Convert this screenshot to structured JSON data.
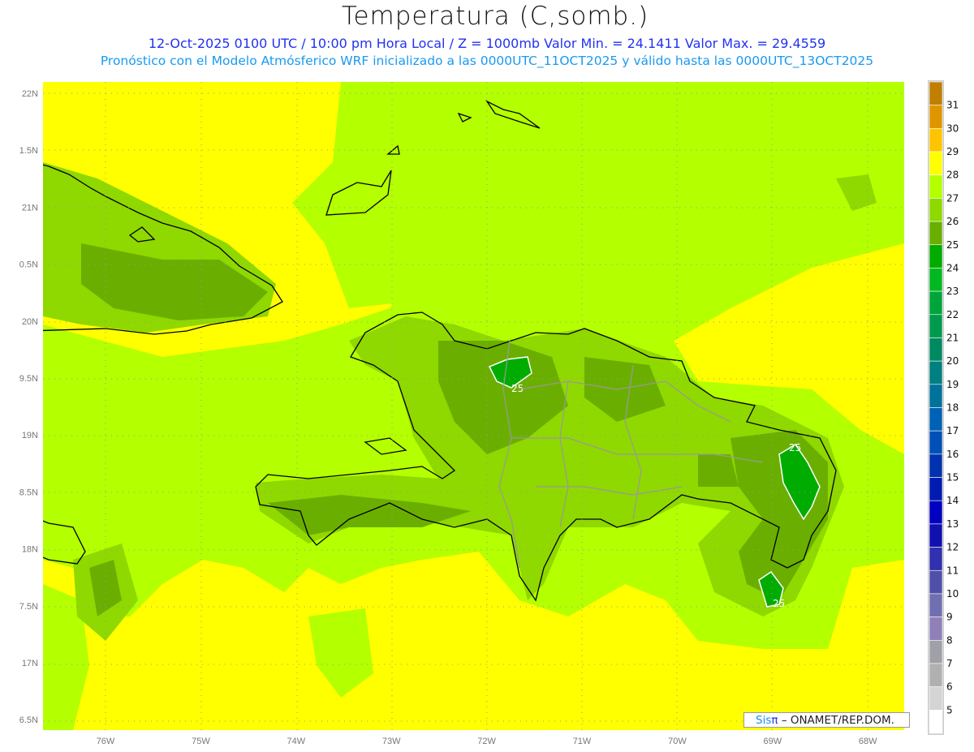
{
  "header": {
    "title": "Temperatura (C,somb.)",
    "subtitle1": "12-Oct-2025 0100 UTC / 10:00 pm Hora Local / Z = 1000mb   Valor Min. = 24.1411   Valor Max. = 29.4559",
    "subtitle2": "Pronóstico con el Modelo Atmósferico WRF inicializado a las 0000UTC_11OCT2025 y válido hasta las  0000UTC_13OCT2025"
  },
  "axes": {
    "lon_labels": [
      "76W",
      "75W",
      "74W",
      "73W",
      "72W",
      "71W",
      "70W",
      "69W",
      "68W"
    ],
    "lon_values": [
      -76,
      -75,
      -74,
      -73,
      -72,
      -71,
      -70,
      -69,
      -68
    ],
    "lat_labels": [
      "22N",
      "1.5N",
      "21N",
      "0.5N",
      "20N",
      "9.5N",
      "19N",
      "8.5N",
      "18N",
      "7.5N",
      "17N",
      "6.5N"
    ],
    "lat_values": [
      22,
      21.5,
      21,
      20.5,
      20,
      19.5,
      19,
      18.5,
      18,
      17.5,
      17,
      16.5
    ]
  },
  "contour_labels": [
    "25",
    "25",
    "25"
  ],
  "colorbar": {
    "labels": [
      "31",
      "30",
      "29",
      "28",
      "27",
      "26",
      "25",
      "24",
      "23",
      "22",
      "21",
      "20",
      "19",
      "18",
      "17",
      "16",
      "15",
      "14",
      "13",
      "12",
      "11",
      "10",
      "9",
      "8",
      "7",
      "6",
      "5"
    ],
    "colors": [
      "#c07f00",
      "#de9600",
      "#ffc400",
      "#ffff00",
      "#b4ff00",
      "#8fd800",
      "#6aaf00",
      "#00ac00",
      "#00b820",
      "#00a53a",
      "#009a4e",
      "#008a62",
      "#008080",
      "#00739a",
      "#0062b4",
      "#0050b8",
      "#0032b0",
      "#001cb0",
      "#0000c0",
      "#1010b0",
      "#3030b0",
      "#5050aa",
      "#7070b0",
      "#9080b8",
      "#a0a0a8",
      "#b0b0b0",
      "#d4d4d4",
      "#ffffff"
    ]
  },
  "credit": {
    "brand_a": "Sis",
    "brand_b": "π",
    "text": " –  ONAMET/REP.DOM."
  }
}
